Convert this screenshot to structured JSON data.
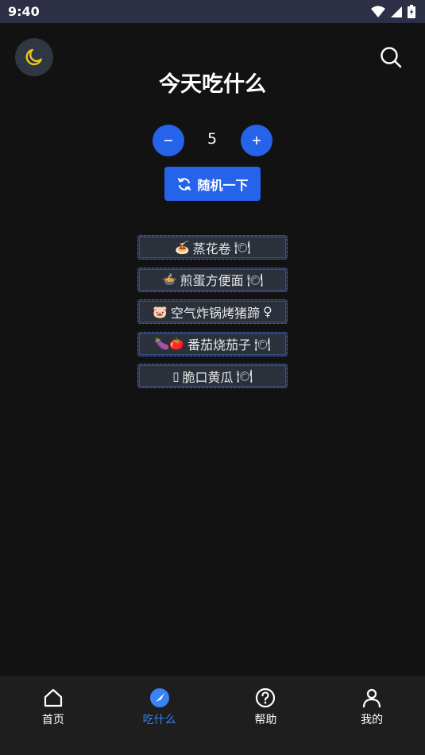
{
  "status_bar": {
    "time": "9:40"
  },
  "header": {
    "title": "今天吃什么"
  },
  "counter": {
    "value": "5",
    "minus": "−",
    "plus": "+"
  },
  "random_button": {
    "label": "随机一下"
  },
  "dishes": [
    {
      "emoji": "🍝",
      "name": "蒸花卷",
      "suffix": "🍽"
    },
    {
      "emoji": "🍲",
      "name": "煎蛋方便面",
      "suffix": "🍽"
    },
    {
      "emoji": "🐷",
      "name": "空气炸锅烤猪蹄",
      "suffix": "♀"
    },
    {
      "emoji": "🍆🍅",
      "name": "番茄烧茄子",
      "suffix": "🍽"
    },
    {
      "emoji": "▯",
      "name": "脆口黄瓜",
      "suffix": "🍽"
    }
  ],
  "bottom_nav": [
    {
      "label": "首页",
      "icon": "home-icon"
    },
    {
      "label": "吃什么",
      "icon": "compass-icon",
      "active": true
    },
    {
      "label": "帮助",
      "icon": "help-icon"
    },
    {
      "label": "我的",
      "icon": "user-icon"
    }
  ],
  "colors": {
    "accent": "#2563eb",
    "moon": "#f5c518",
    "active_nav": "#3b82f6"
  }
}
